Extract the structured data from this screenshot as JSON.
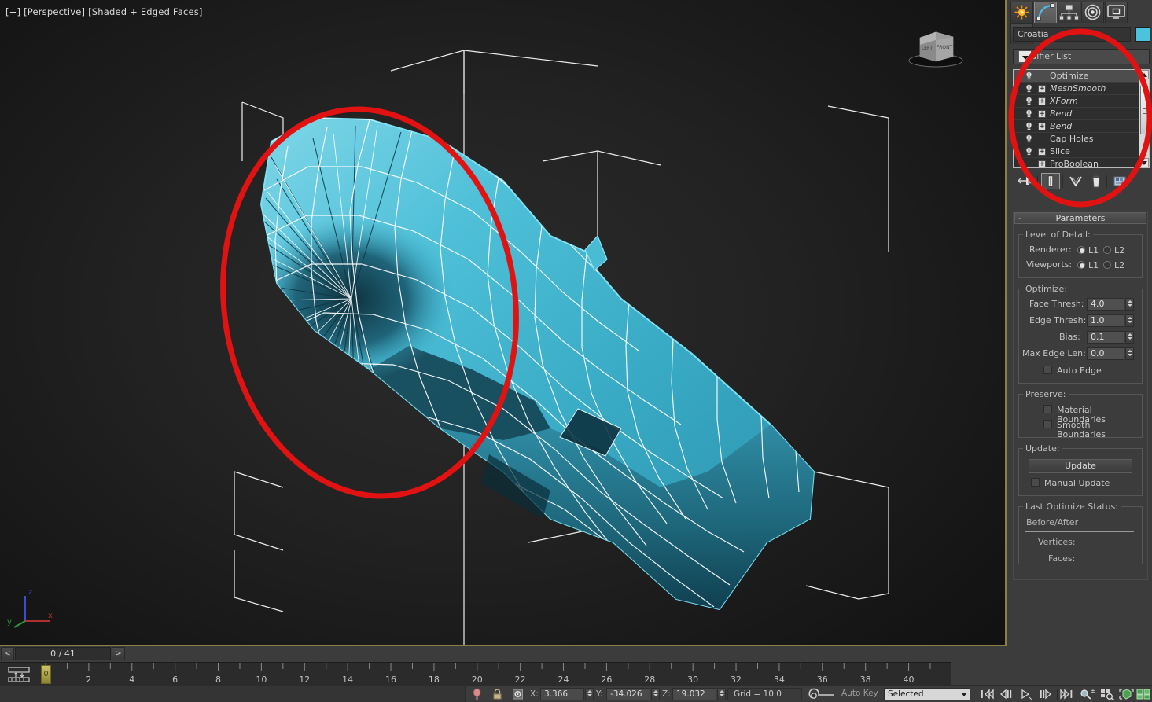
{
  "viewport": {
    "label": "[+] [Perspective] [Shaded + Edged Faces]",
    "background_color": "#1c1c1c",
    "object_color": "#3bafc8",
    "wire_color": "#ffffff",
    "helper_color": "#ffffff",
    "viewcube": {
      "face_left": "LEFT",
      "face_front": "FRONT"
    },
    "axis": {
      "x": "x",
      "y": "y",
      "z": "z",
      "x_color": "#b03030",
      "y_color": "#2f9a3f",
      "z_color": "#3a4fd0"
    }
  },
  "annotation": {
    "shape": "ellipse",
    "color": "#e01212",
    "count": 2,
    "targets": [
      "modifier-stack",
      "model-pinch-artifact"
    ]
  },
  "timeslider": {
    "prev_label": "<",
    "next_label": ">",
    "frame_text": "0 / 41"
  },
  "trackbar": {
    "current_frame": "0",
    "start": 0,
    "end": 41,
    "tick_labels": [
      "0",
      "2",
      "4",
      "6",
      "8",
      "10",
      "12",
      "14",
      "16",
      "18",
      "20",
      "22",
      "24",
      "26",
      "28",
      "30",
      "32",
      "34",
      "36",
      "38",
      "40"
    ],
    "open_minieditor_icon": "track-view-icon"
  },
  "statusbar": {
    "pin_icon": "pin-stack-icon",
    "lock_icon": "selection-lock-icon",
    "abs_icon": "absolute-relative-icon",
    "coords": [
      {
        "label": "X:",
        "value": "3.366"
      },
      {
        "label": "Y:",
        "value": "-34.026"
      },
      {
        "label": "Z:",
        "value": "19.032"
      }
    ],
    "grid": "Grid = 10.0",
    "anim_icon": "add-time-tag-icon",
    "autokey_label": "Auto Key",
    "selection_filter": "Selected",
    "playback": [
      {
        "name": "go-to-start-icon",
        "glyph": "|◀◀"
      },
      {
        "name": "previous-frame-icon",
        "glyph": "◀||"
      },
      {
        "name": "play-animation-icon",
        "glyph": "▷"
      },
      {
        "name": "next-frame-icon",
        "glyph": "||▷"
      },
      {
        "name": "go-to-end-icon",
        "glyph": "▶▶|"
      }
    ],
    "navigation": [
      {
        "name": "zoom-icon"
      },
      {
        "name": "zoom-region-icon"
      },
      {
        "name": "zoom-extents-icon"
      },
      {
        "name": "zoom-extents-all-icon"
      }
    ]
  },
  "command_panel": {
    "tabs": [
      {
        "name": "create-tab",
        "icon": "star-icon",
        "active": false
      },
      {
        "name": "modify-tab",
        "icon": "arc-icon",
        "active": true
      },
      {
        "name": "hierarchy-tab",
        "icon": "hierarchy-icon",
        "active": false
      },
      {
        "name": "motion-tab",
        "icon": "wheel-icon",
        "active": false
      },
      {
        "name": "display-tab",
        "icon": "monitor-icon",
        "active": false
      },
      {
        "name": "utilities-tab",
        "icon": "hammer-icon",
        "active": false
      }
    ],
    "object_name": "Croatia",
    "object_color": "#4cc3dd",
    "modifier_list_label": "Modifier List",
    "stack": [
      {
        "label": "Optimize",
        "selected": true,
        "italic": false,
        "expandable": false,
        "light": true
      },
      {
        "label": "MeshSmooth",
        "selected": false,
        "italic": true,
        "expandable": true,
        "light": true
      },
      {
        "label": "XForm",
        "selected": false,
        "italic": true,
        "expandable": true,
        "light": true
      },
      {
        "label": "Bend",
        "selected": false,
        "italic": true,
        "expandable": true,
        "light": true
      },
      {
        "label": "Bend",
        "selected": false,
        "italic": true,
        "expandable": true,
        "light": true
      },
      {
        "label": "Cap Holes",
        "selected": false,
        "italic": false,
        "expandable": false,
        "light": true
      },
      {
        "label": "Slice",
        "selected": false,
        "italic": false,
        "expandable": true,
        "light": true
      },
      {
        "label": "ProBoolean",
        "selected": false,
        "italic": false,
        "expandable": true,
        "light": false
      }
    ],
    "stack_buttons": [
      {
        "name": "pin-stack-button",
        "icon": "pin-icon",
        "active": false
      },
      {
        "name": "show-end-result-button",
        "icon": "end-result-icon",
        "active": true
      },
      {
        "name": "make-unique-button",
        "icon": "make-unique-icon",
        "active": false
      },
      {
        "name": "remove-modifier-button",
        "icon": "trash-icon",
        "active": false
      },
      {
        "name": "configure-sets-button",
        "icon": "configure-icon",
        "active": false
      }
    ]
  },
  "parameters": {
    "rollout_title": "Parameters",
    "collapse_glyph": "-",
    "level_of_detail": {
      "legend": "Level of Detail:",
      "rows": [
        {
          "label": "Renderer:",
          "options": [
            "L1",
            "L2"
          ],
          "selected": "L1"
        },
        {
          "label": "Viewports:",
          "options": [
            "L1",
            "L2"
          ],
          "selected": "L1"
        }
      ]
    },
    "optimize": {
      "legend": "Optimize:",
      "fields": [
        {
          "label": "Face Thresh:",
          "value": "4.0"
        },
        {
          "label": "Edge Thresh:",
          "value": "1.0"
        },
        {
          "label": "Bias:",
          "value": "0.1"
        },
        {
          "label": "Max Edge Len:",
          "value": "0.0"
        }
      ],
      "auto_edge": {
        "label": "Auto Edge",
        "checked": false
      }
    },
    "preserve": {
      "legend": "Preserve:",
      "checks": [
        {
          "label": "Material Boundaries",
          "checked": false
        },
        {
          "label": "Smooth Boundaries",
          "checked": false
        }
      ]
    },
    "update": {
      "legend": "Update:",
      "button": "Update",
      "manual": {
        "label": "Manual Update",
        "checked": false
      }
    },
    "status": {
      "legend": "Last Optimize Status:",
      "header": "Before/After",
      "rows": [
        {
          "label": "Vertices:",
          "value": ""
        },
        {
          "label": "Faces:",
          "value": ""
        }
      ]
    }
  }
}
